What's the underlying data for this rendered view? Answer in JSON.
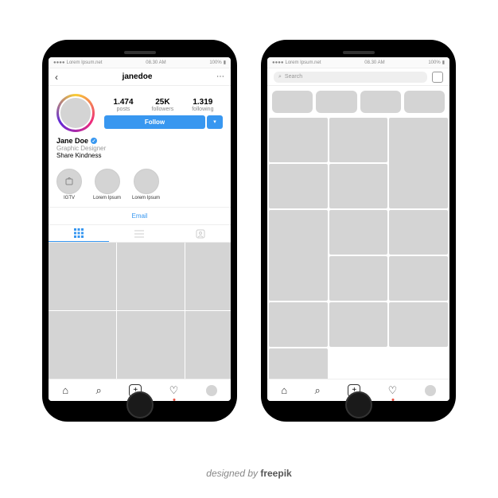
{
  "statusbar": {
    "carrier": "Lorem Ipsum.net",
    "time": "08.30 AM",
    "battery": "100%"
  },
  "profile": {
    "username": "janedoe",
    "stats": {
      "posts_num": "1.474",
      "posts_lbl": "posts",
      "followers_num": "25K",
      "followers_lbl": "followers",
      "following_num": "1.319",
      "following_lbl": "following"
    },
    "follow_label": "Follow",
    "dropdown_glyph": "▾",
    "display_name": "Jane Doe",
    "verified_glyph": "✓",
    "subtitle": "Graphic Designer",
    "tagline": "Share Kindness",
    "highlights": [
      {
        "label": "IGTV"
      },
      {
        "label": "Lorem Ipsum"
      },
      {
        "label": "Lorem Ipsum"
      }
    ],
    "email_label": "Email"
  },
  "search": {
    "placeholder": "Search",
    "icon": "⌕"
  },
  "nav": {
    "home": "⌂",
    "search": "⌕",
    "add": "+",
    "heart": "♡"
  },
  "credit": {
    "prefix": "designed by ",
    "brand": "freepik"
  }
}
